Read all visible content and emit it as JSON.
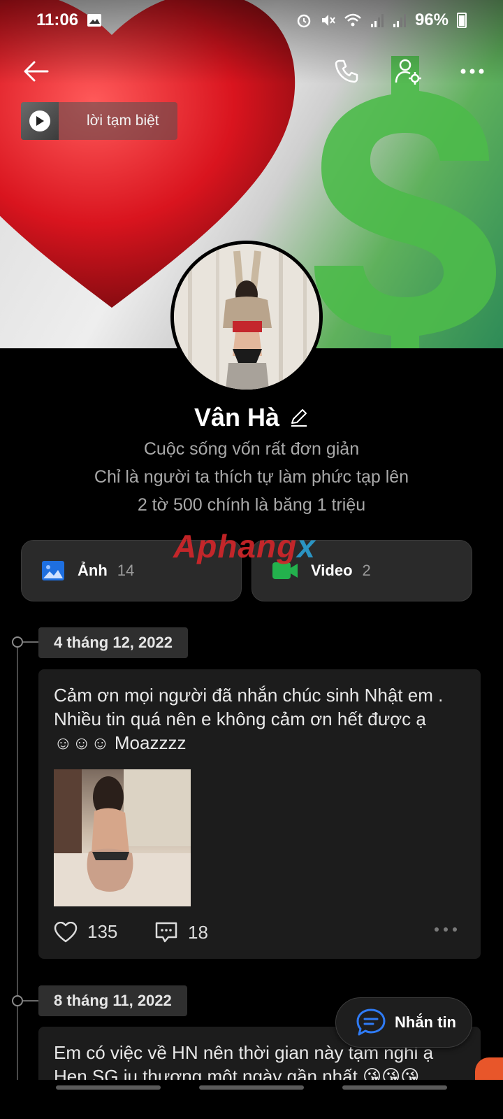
{
  "status_bar": {
    "time": "11:06",
    "battery": "96%"
  },
  "music": {
    "title": "lời tạm biệt"
  },
  "profile": {
    "name": "Vân Hà",
    "bio_line1": "Cuộc sống vốn rất đơn giản",
    "bio_line2": "Chỉ là người ta thích tự làm phức tạp lên",
    "bio_line3": "2 tờ 500 chính là băng 1 triệu"
  },
  "media": {
    "photos_label": "Ảnh",
    "photos_count": "14",
    "videos_label": "Video",
    "videos_count": "2"
  },
  "watermark": {
    "main": "Aphang",
    "x": "x"
  },
  "posts": [
    {
      "date": "4 tháng 12, 2022",
      "line1": "Cảm ơn mọi người đã nhắn chúc sinh Nhật em .",
      "line2": "Nhiều tin quá nên e không cảm ơn hết được ạ",
      "line3": "☺☺☺ Moazzzz",
      "likes": "135",
      "comments": "18"
    },
    {
      "date": "8 tháng 11, 2022",
      "line1": "Em có việc về HN nên thời gian này tạm nghỉ ạ",
      "line2": "Hẹn SG iu thương một ngày gần nhất 😘😘😘"
    }
  ],
  "message_button": {
    "label": "Nhắn tin"
  },
  "colors": {
    "background": "#000000",
    "card": "#1c1c1c",
    "photo_icon": "#1e6fe0",
    "video_icon": "#23b14d",
    "message_icon": "#2f7bf5"
  },
  "icons": [
    "back-arrow-icon",
    "phone-icon",
    "user-settings-icon",
    "more-icon",
    "play-icon",
    "edit-pencil-icon",
    "photo-icon",
    "video-camera-icon",
    "heart-icon",
    "comment-icon",
    "chat-bubble-icon"
  ]
}
